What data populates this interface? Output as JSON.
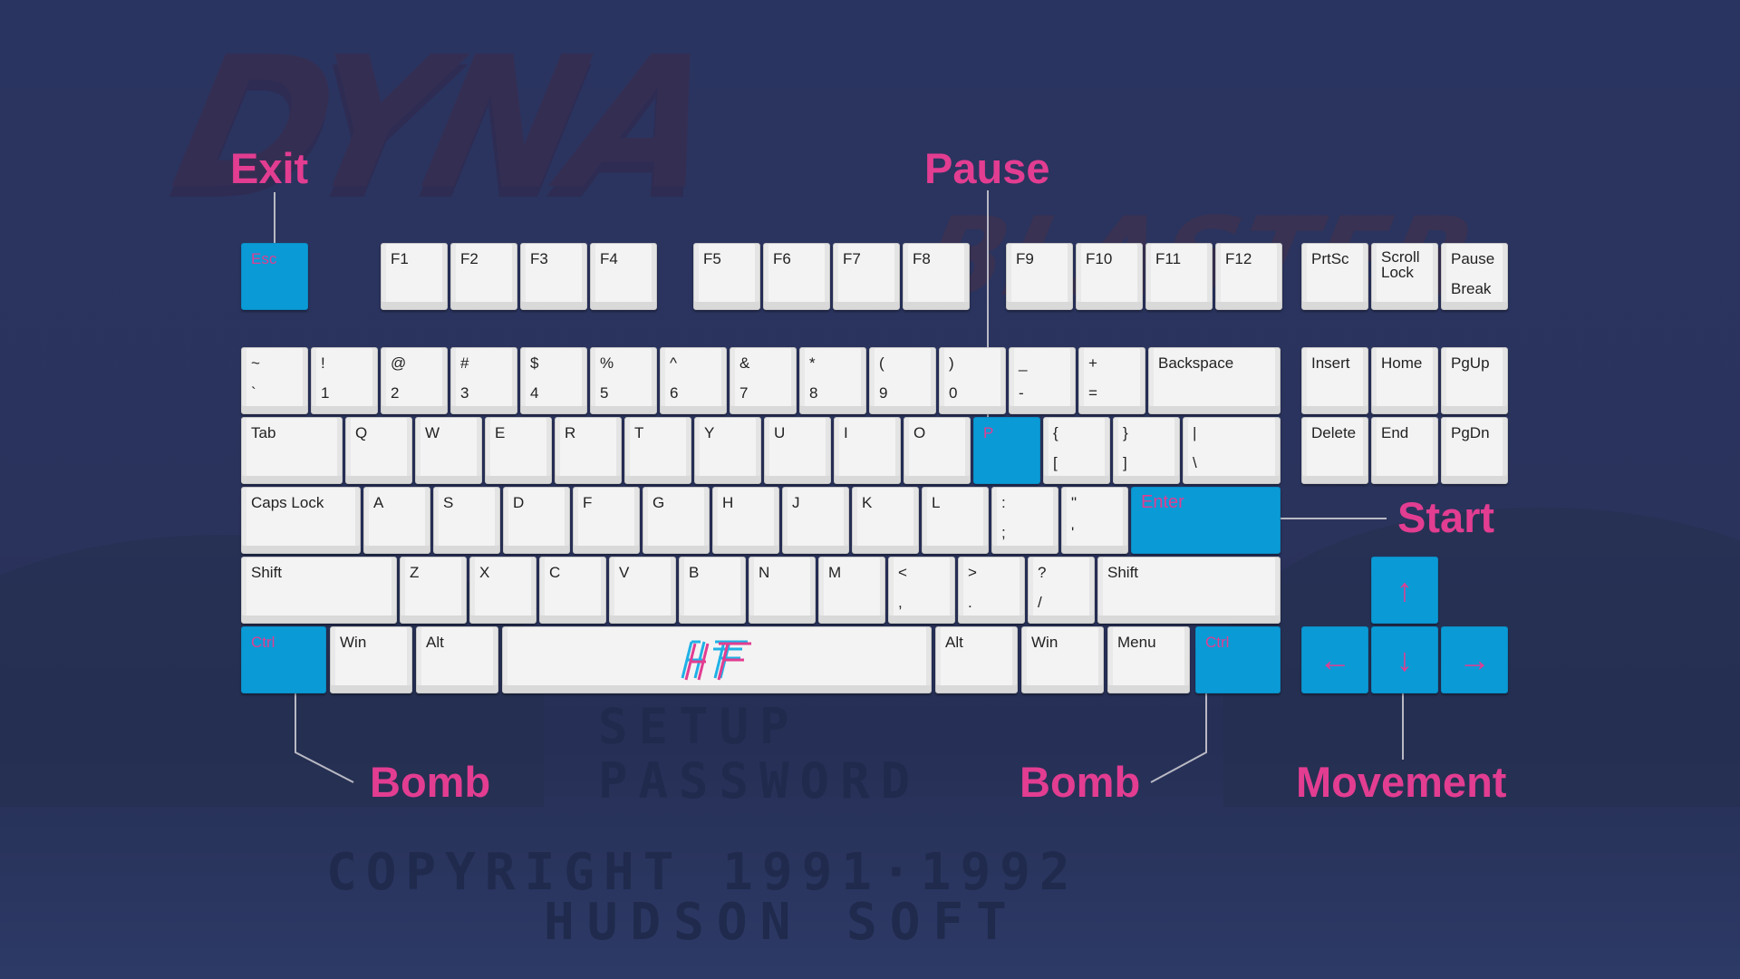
{
  "background": {
    "logo_top": "DYNA",
    "logo_bottom": "BLASTER",
    "menu": [
      "SETUP",
      "PASSWORD"
    ],
    "copyright": "COPYRIGHT 1991·1992",
    "publisher": "HUDSON SOFT"
  },
  "labels": {
    "exit": "Exit",
    "pause": "Pause",
    "start": "Start",
    "bomb_left": "Bomb",
    "bomb_right": "Bomb",
    "movement": "Movement"
  },
  "colors": {
    "highlight": "#0a9bd6",
    "label": "#e23d91",
    "key": "#f3f3f3",
    "background": "#29335b"
  },
  "keyboard": {
    "function_row": {
      "esc": "Esc",
      "f": [
        "F1",
        "F2",
        "F3",
        "F4",
        "F5",
        "F6",
        "F7",
        "F8",
        "F9",
        "F10",
        "F11",
        "F12"
      ],
      "prtsc": "PrtSc",
      "scroll": [
        "Scroll",
        "Lock"
      ],
      "pause": [
        "Pause",
        "Break"
      ]
    },
    "number_row": [
      {
        "top": "~",
        "bottom": "`"
      },
      {
        "top": "!",
        "bottom": "1"
      },
      {
        "top": "@",
        "bottom": "2"
      },
      {
        "top": "#",
        "bottom": "3"
      },
      {
        "top": "$",
        "bottom": "4"
      },
      {
        "top": "%",
        "bottom": "5"
      },
      {
        "top": "^",
        "bottom": "6"
      },
      {
        "top": "&",
        "bottom": "7"
      },
      {
        "top": "*",
        "bottom": "8"
      },
      {
        "top": "(",
        "bottom": "9"
      },
      {
        "top": ")",
        "bottom": "0"
      },
      {
        "top": "_",
        "bottom": "-"
      },
      {
        "top": "+",
        "bottom": "="
      }
    ],
    "backspace": "Backspace",
    "tab": "Tab",
    "qwerty": [
      "Q",
      "W",
      "E",
      "R",
      "T",
      "Y",
      "U",
      "I",
      "O",
      "P"
    ],
    "brackets": [
      {
        "top": "{",
        "bottom": "["
      },
      {
        "top": "}",
        "bottom": "]"
      },
      {
        "top": "|",
        "bottom": "\\"
      }
    ],
    "caps": "Caps Lock",
    "home_row": [
      "A",
      "S",
      "D",
      "F",
      "G",
      "H",
      "J",
      "K",
      "L"
    ],
    "semicolon": {
      "top": ":",
      "bottom": ";"
    },
    "quote": {
      "top": "\"",
      "bottom": "'"
    },
    "enter": "Enter",
    "shift": "Shift",
    "bottom_letters": [
      "Z",
      "X",
      "C",
      "V",
      "B",
      "N",
      "M"
    ],
    "punct": [
      {
        "top": "<",
        "bottom": ","
      },
      {
        "top": ">",
        "bottom": "."
      },
      {
        "top": "?",
        "bottom": "/"
      }
    ],
    "ctrl": "Ctrl",
    "win": "Win",
    "alt": "Alt",
    "menu": "Menu",
    "space_logo": "HF",
    "nav": {
      "insert": "Insert",
      "home": "Home",
      "pgup": "PgUp",
      "delete": "Delete",
      "end": "End",
      "pgdn": "PgDn"
    },
    "arrows": {
      "up": "↑",
      "left": "←",
      "down": "↓",
      "right": "→"
    }
  }
}
